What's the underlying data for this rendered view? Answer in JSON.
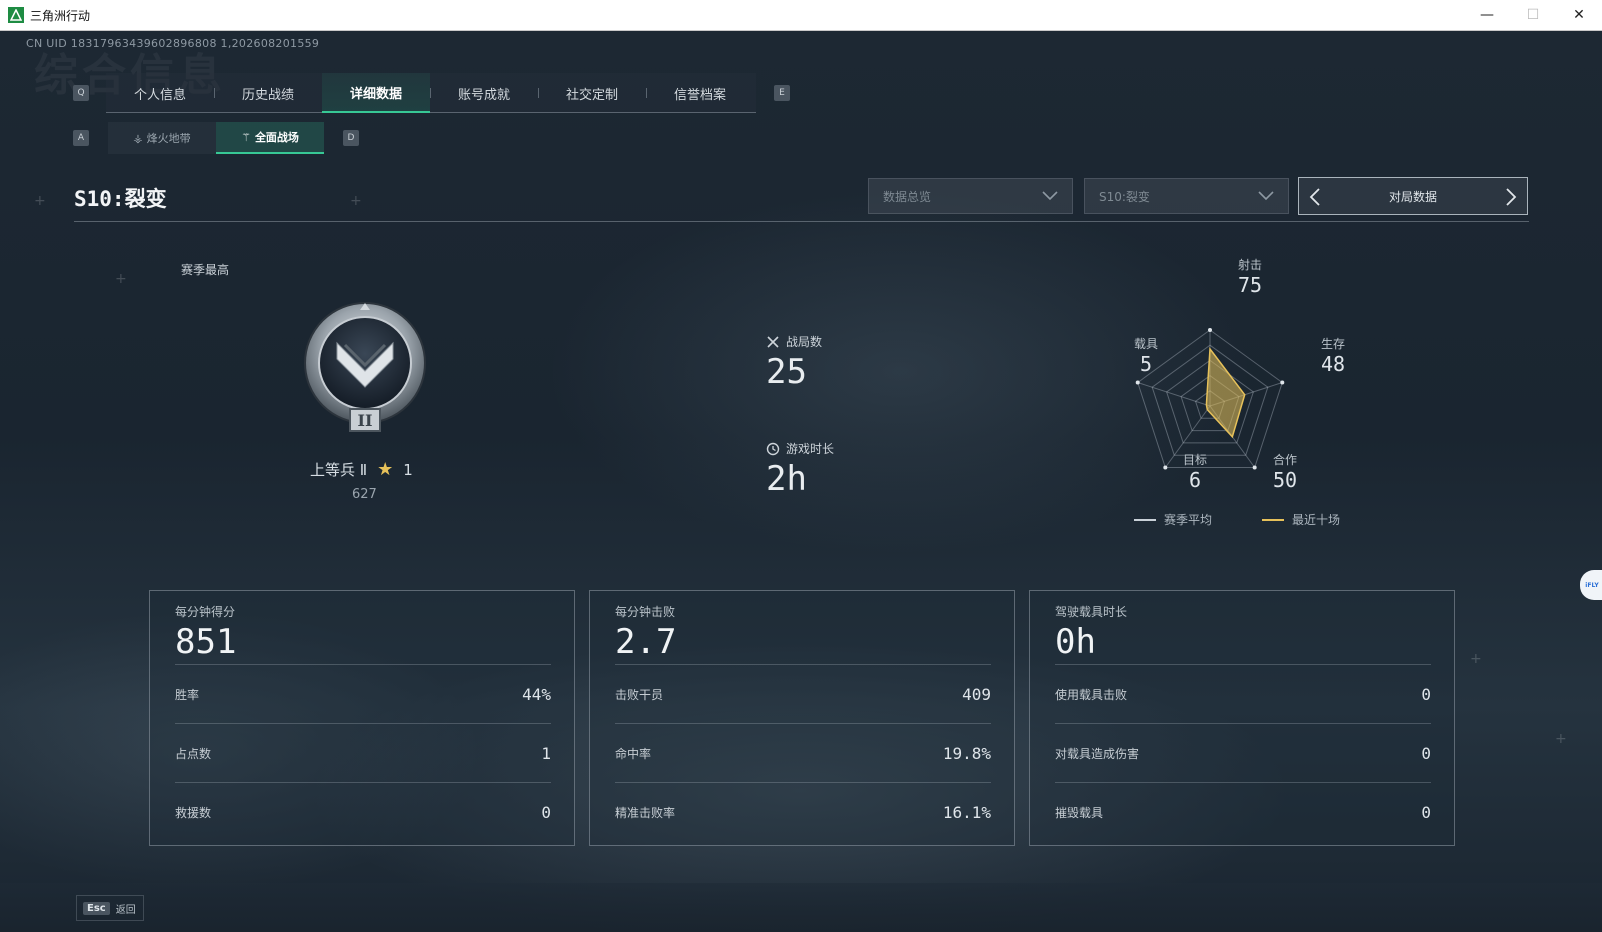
{
  "window": {
    "title": "三角洲行动",
    "minimize_glyph": "—",
    "maximize_glyph": "☐",
    "close_glyph": "✕"
  },
  "uid_text": "CN UID 18317963439602896808 1,202608201559",
  "bg_watermark": "综合信息",
  "tabs": {
    "prev_key": "Q",
    "next_key": "E",
    "items": [
      {
        "label": "个人信息"
      },
      {
        "label": "历史战绩"
      },
      {
        "label": "详细数据",
        "active": true
      },
      {
        "label": "账号成就"
      },
      {
        "label": "社交定制"
      },
      {
        "label": "信誉档案"
      }
    ]
  },
  "subtabs": {
    "prev_key": "A",
    "next_key": "D",
    "items": [
      {
        "label": "烽火地带"
      },
      {
        "label": "全面战场",
        "active": true
      }
    ]
  },
  "season": {
    "title": "S10:裂变",
    "dropdown_mode": "数据总览",
    "dropdown_season": "S10:裂变",
    "pager_label": "对局数据"
  },
  "rank": {
    "section_label": "赛季最高",
    "name": "上等兵 Ⅱ",
    "stars": "1",
    "score": "627",
    "badge_numeral": "II"
  },
  "summary": {
    "matches_label": "战局数",
    "matches_value": "25",
    "playtime_label": "游戏时长",
    "playtime_value": "2h"
  },
  "radar": {
    "axes": [
      {
        "name": "射击",
        "value": "75"
      },
      {
        "name": "生存",
        "value": "48"
      },
      {
        "name": "合作",
        "value": "50"
      },
      {
        "name": "目标",
        "value": "6"
      },
      {
        "name": "载具",
        "value": "5"
      }
    ],
    "legend": [
      {
        "label": "赛季平均",
        "color": "#c9d1d8"
      },
      {
        "label": "最近十场",
        "color": "#e6c15a"
      }
    ],
    "fill_color": "#e6c15a"
  },
  "cards": [
    {
      "title": "每分钟得分",
      "value": "851",
      "rows": [
        {
          "k": "胜率",
          "v": "44%"
        },
        {
          "k": "占点数",
          "v": "1"
        },
        {
          "k": "救援数",
          "v": "0"
        }
      ]
    },
    {
      "title": "每分钟击败",
      "value": "2.7",
      "rows": [
        {
          "k": "击败干员",
          "v": "409"
        },
        {
          "k": "命中率",
          "v": "19.8%"
        },
        {
          "k": "精准击败率",
          "v": "16.1%"
        }
      ]
    },
    {
      "title": "驾驶载具时长",
      "value": "0h",
      "rows": [
        {
          "k": "使用载具击败",
          "v": "0"
        },
        {
          "k": "对载具造成伤害",
          "v": "0"
        },
        {
          "k": "摧毁载具",
          "v": "0"
        }
      ]
    }
  ],
  "footer": {
    "esc_key": "Esc",
    "esc_label": "返回"
  },
  "side_badge_text": "iFLY",
  "colors": {
    "accent": "#37c895",
    "radar_fill": "#e6c15a"
  }
}
